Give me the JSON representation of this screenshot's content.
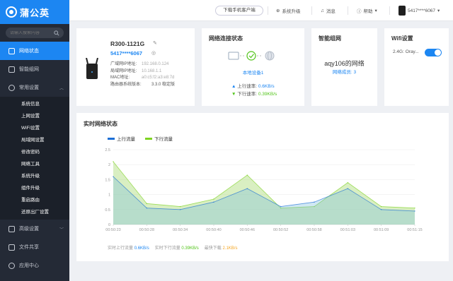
{
  "brand": {
    "name": "蒲公英",
    "accent": "#1c86f2",
    "sidebar_bg": "#242a36"
  },
  "sidebar": {
    "search_placeholder": "请输入搜索内容",
    "items": [
      {
        "label": "网络状态",
        "icon": "monitor-icon",
        "active": true
      },
      {
        "label": "智能组网",
        "icon": "network-icon"
      },
      {
        "label": "常用设置",
        "icon": "gear-icon",
        "expanded": true
      }
    ],
    "sub_items": [
      "系统信息",
      "上网设置",
      "WiFi设置",
      "局域网设置",
      "修改密码",
      "网络工具",
      "系统升级",
      "组件升级",
      "重启路由",
      "还原出厂设置"
    ],
    "bottom_items": [
      {
        "label": "高级设置",
        "icon": "advanced-icon"
      },
      {
        "label": "文件共享",
        "icon": "folder-icon"
      },
      {
        "label": "应用中心",
        "icon": "apps-icon"
      }
    ]
  },
  "header": {
    "download_btn": "下载手机客户端",
    "upgrade": "系统升级",
    "messages": "消息",
    "help": "帮助",
    "user": "5417****6067"
  },
  "device": {
    "model": "R300-1121G",
    "sn": "5417****6067",
    "rows": [
      {
        "label": "广域网IP地址:",
        "value": "192.168.0.124"
      },
      {
        "label": "局域网IP地址:",
        "value": "10.168.1.1"
      },
      {
        "label": "MAC地址:",
        "value": "a0:c5:f2:a3:e8:7d"
      },
      {
        "label": "路由器系统版本:",
        "value": "3.3.0 稳定版"
      }
    ]
  },
  "connection": {
    "title": "网络连接状态",
    "link": "本地设备1",
    "upload_label": "上行速率:",
    "upload_value": "0.6KB/s",
    "download_label": "下行速率:",
    "download_value": "0.39KB/s"
  },
  "smartnet": {
    "title": "智能组网",
    "name": "aqy106的网络",
    "members_label": "网络成员:",
    "members_value": "3"
  },
  "wifi": {
    "title": "Wifi设置",
    "band": "2.4G:",
    "ssid": "Oray...",
    "enabled": true
  },
  "realtime": {
    "title": "实时网络状态",
    "footer_up_label": "实时上行流量",
    "footer_up_value": "0.6KB/s",
    "footer_down_label": "实时下行流量",
    "footer_down_value": "0.39KB/s",
    "footer_peak_label": "最快下载",
    "footer_peak_value": "2.1KB/s"
  },
  "chart_data": {
    "type": "area",
    "x": [
      "00:50:23",
      "00:50:28",
      "00:50:34",
      "00:50:40",
      "00:50:46",
      "00:50:52",
      "00:50:58",
      "00:51:03",
      "00:51:09",
      "00:51:15"
    ],
    "ylim": [
      0,
      2.5
    ],
    "yticks": [
      0,
      0.5,
      1,
      1.5,
      2,
      2.5
    ],
    "series": [
      {
        "name": "上行流量",
        "color": "#1c6fd6",
        "values": [
          1.6,
          0.55,
          0.5,
          0.75,
          1.2,
          0.6,
          0.75,
          1.2,
          0.5,
          0.45
        ]
      },
      {
        "name": "下行流量",
        "color": "#7ed321",
        "values": [
          2.1,
          0.7,
          0.6,
          0.85,
          1.65,
          0.55,
          0.6,
          1.4,
          0.6,
          0.55
        ]
      }
    ]
  }
}
